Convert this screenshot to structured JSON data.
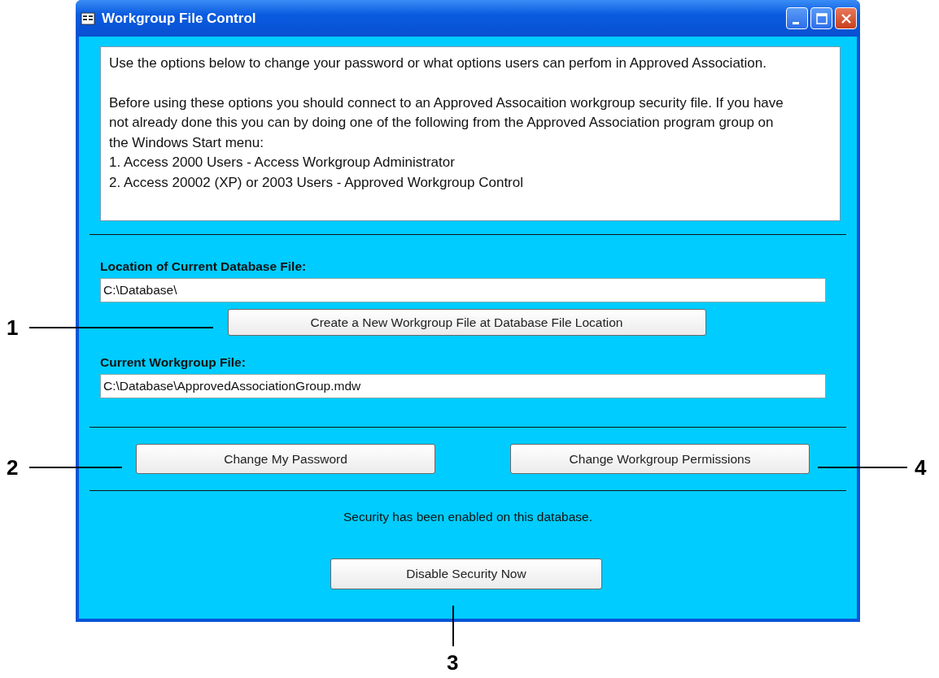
{
  "window": {
    "title": "Workgroup File Control"
  },
  "info": {
    "paragraphs": [
      "Use the options below to change your password or what options users can perfom in Approved Association.",
      "Before using these options you should connect to an Approved Assocaition workgroup security file.  If you have not already done this you can by doing one of the following from the Approved Association program group on the Windows Start menu:"
    ],
    "list_items": [
      "1. Access 2000 Users - Access Workgroup Administrator",
      "2. Access 20002 (XP) or 2003 Users - Approved Workgroup Control"
    ]
  },
  "database_location": {
    "label": "Location of Current Database File:",
    "value": "C:\\Database\\"
  },
  "create_button": "Create a New Workgroup File at Database File Location",
  "current_workgroup": {
    "label": "Current Workgroup File:",
    "value": "C:\\Database\\ApprovedAssociationGroup.mdw"
  },
  "buttons": [
    "Change My Password",
    "Change Workgroup Permissions"
  ],
  "status": "Security has been enabled on this database.",
  "disable_button": "Disable Security Now",
  "callouts": [
    {
      "label": "1"
    },
    {
      "label": "2"
    },
    {
      "label": "4"
    },
    {
      "label": "3"
    }
  ]
}
